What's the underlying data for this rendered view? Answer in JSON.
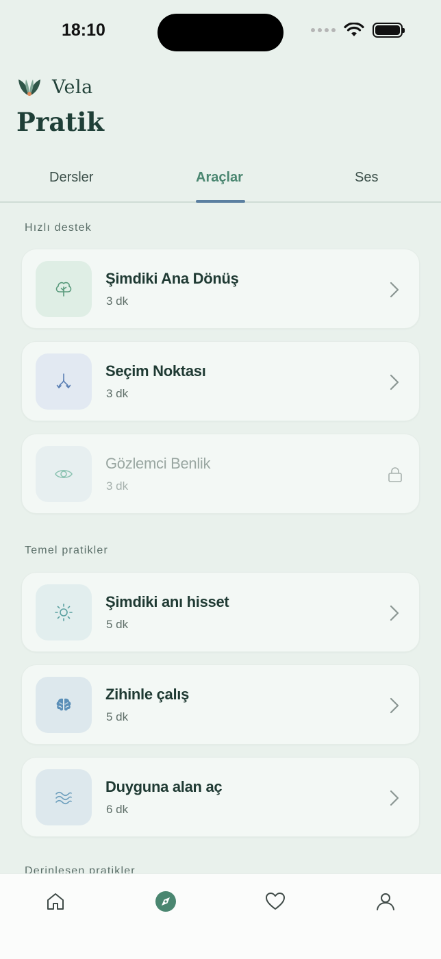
{
  "status_bar": {
    "time": "18:10"
  },
  "brand": {
    "name": "Vela",
    "logo": "leaf-logo"
  },
  "page": {
    "title": "Pratik"
  },
  "tabs": [
    {
      "label": "Dersler",
      "active": false
    },
    {
      "label": "Araçlar",
      "active": true
    },
    {
      "label": "Ses",
      "active": false
    }
  ],
  "sections": [
    {
      "label": "Hızlı destek",
      "items": [
        {
          "title": "Şimdiki Ana Dönüş",
          "duration": "3 dk",
          "icon": "tree-icon",
          "locked": false
        },
        {
          "title": "Seçim Noktası",
          "duration": "3 dk",
          "icon": "split-arrows-icon",
          "locked": false
        },
        {
          "title": "Gözlemci Benlik",
          "duration": "3 dk",
          "icon": "eye-icon",
          "locked": true
        }
      ]
    },
    {
      "label": "Temel pratikler",
      "items": [
        {
          "title": "Şimdiki anı hisset",
          "duration": "5 dk",
          "icon": "sun-icon",
          "locked": false
        },
        {
          "title": "Zihinle çalış",
          "duration": "5 dk",
          "icon": "brain-icon",
          "locked": false
        },
        {
          "title": "Duyguna alan aç",
          "duration": "6 dk",
          "icon": "waves-icon",
          "locked": false
        }
      ]
    },
    {
      "label": "Derinleşen pratikler"
    }
  ],
  "bottom_nav": [
    {
      "icon": "home-icon",
      "active": false
    },
    {
      "icon": "compass-icon",
      "active": true
    },
    {
      "icon": "heart-icon",
      "active": false
    },
    {
      "icon": "profile-icon",
      "active": false
    }
  ],
  "colors": {
    "accent": "#4a8670",
    "tab_indicator": "#5b7fa0",
    "background": "#e9f1ec"
  }
}
